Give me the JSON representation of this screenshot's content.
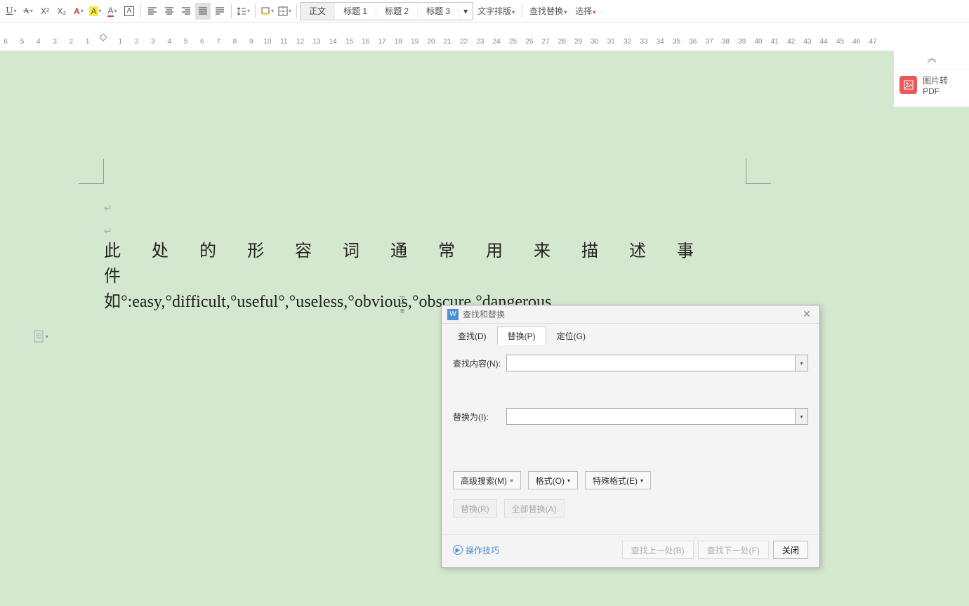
{
  "toolbar": {
    "underline": "U",
    "super": "X²",
    "sub": "X₂",
    "font_a1": "A",
    "font_a2": "A",
    "font_a3": "A",
    "char_box": "A",
    "styles": {
      "body": "正文",
      "h1": "标题 1",
      "h2": "标题 2",
      "h3": "标题 3"
    },
    "text_layout": "文字排版",
    "find_replace": "查找替换",
    "select": "选择"
  },
  "ruler": {
    "left": [
      "6",
      "5",
      "4",
      "3",
      "2",
      "1"
    ],
    "right_count": 47
  },
  "doc": {
    "line1": "此处的形容词通常用来描述事件",
    "line2": "如°:easy,°difficult,°useful°,°useless,°obvious,°obscure,°dangerous."
  },
  "side": {
    "pdf": "图片转PDF"
  },
  "dialog": {
    "title": "查找和替换",
    "tabs": {
      "find": "查找(D)",
      "replace": "替换(P)",
      "goto": "定位(G)"
    },
    "find_label": "查找内容(N):",
    "replace_label": "替换为(I):",
    "adv_search": "高级搜索(M)",
    "format": "格式(O)",
    "special": "特殊格式(E)",
    "replace_btn": "替换(R)",
    "replace_all": "全部替换(A)",
    "tips": "操作技巧",
    "find_prev": "查找上一处(B)",
    "find_next": "查找下一处(F)",
    "close": "关闭"
  }
}
